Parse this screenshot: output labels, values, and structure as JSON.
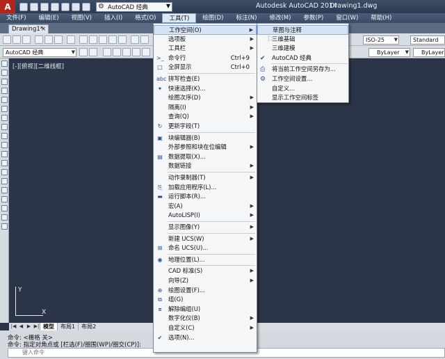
{
  "titlebar": {
    "app_title": "Autodesk AutoCAD 2014",
    "doc_title": "Drawing1.dwg",
    "workspace_select": "AutoCAD 经典",
    "logo": "A"
  },
  "menubar": [
    "文件(F)",
    "编辑(E)",
    "视图(V)",
    "插入(I)",
    "格式(O)",
    "工具(T)",
    "绘图(D)",
    "标注(N)",
    "修改(M)",
    "参数(P)",
    "窗口(W)",
    "帮助(H)"
  ],
  "doc_tab": {
    "label": "Drawing1*",
    "close": "×"
  },
  "toolbar": {
    "workspace_combo": "AutoCAD 经典",
    "dimstyle_combo": "ISO-25",
    "textstyle_combo": "Standard",
    "linetype_combo": "ByLayer",
    "lineweight_combo": "ByLayer"
  },
  "viewport_label": "[-][俯视][二维线框]",
  "ucs": {
    "x": "X",
    "y": "Y"
  },
  "layout_tabs": [
    "模型",
    "布局1",
    "布局2"
  ],
  "command": {
    "line1": "命令: <栅格 关>",
    "line2": "命令: 指定对角点或 [栏选(F)/圈围(WP)/圈交(CP)]:",
    "placeholder": "键入命令"
  },
  "tools_menu": [
    {
      "label": "工作空间(O)",
      "submenu": true,
      "highlight": true
    },
    {
      "label": "选项板",
      "submenu": true
    },
    {
      "label": "工具栏",
      "submenu": true
    },
    {
      "label": "命令行",
      "shortcut": "Ctrl+9",
      "icon": ">_"
    },
    {
      "label": "全屏显示",
      "shortcut": "Ctrl+0",
      "icon": "□"
    },
    {
      "sep": true
    },
    {
      "label": "拼写检查(E)",
      "icon": "abc"
    },
    {
      "label": "快速选择(K)...",
      "icon": "✦"
    },
    {
      "label": "绘图次序(D)",
      "submenu": true
    },
    {
      "label": "隔离(I)",
      "submenu": true
    },
    {
      "label": "查询(Q)",
      "submenu": true
    },
    {
      "label": "更新字段(T)",
      "icon": "↻"
    },
    {
      "sep": true
    },
    {
      "label": "块编辑器(B)",
      "icon": "▣"
    },
    {
      "label": "外部参照和块在位编辑",
      "submenu": true
    },
    {
      "label": "数据提取(X)...",
      "icon": "▤"
    },
    {
      "label": "数据链接",
      "submenu": true
    },
    {
      "sep": true
    },
    {
      "label": "动作录制器(T)",
      "submenu": true
    },
    {
      "label": "加载应用程序(L)...",
      "icon": "⎘"
    },
    {
      "label": "运行脚本(R)...",
      "icon": "▬"
    },
    {
      "label": "宏(A)",
      "submenu": true
    },
    {
      "label": "AutoLISP(I)",
      "submenu": true
    },
    {
      "sep": true
    },
    {
      "label": "显示图像(Y)",
      "submenu": true
    },
    {
      "sep": true
    },
    {
      "label": "新建 UCS(W)",
      "submenu": true
    },
    {
      "label": "命名 UCS(U)...",
      "icon": "⊞"
    },
    {
      "sep": true
    },
    {
      "label": "地理位置(L)...",
      "icon": "◉"
    },
    {
      "sep": true
    },
    {
      "label": "CAD 标准(S)",
      "submenu": true
    },
    {
      "label": "向导(Z)",
      "submenu": true
    },
    {
      "label": "绘图设置(F)...",
      "icon": "⊕"
    },
    {
      "label": "组(G)",
      "icon": "⧉"
    },
    {
      "label": "解除编组(U)",
      "icon": "⧈"
    },
    {
      "label": "数字化仪(B)",
      "submenu": true
    },
    {
      "label": "自定义(C)",
      "submenu": true
    },
    {
      "label": "选项(N)...",
      "icon": "✔"
    }
  ],
  "workspace_submenu": [
    {
      "label": "草图与注释",
      "highlight": true
    },
    {
      "label": "三维基础"
    },
    {
      "label": "三维建模"
    },
    {
      "label": "AutoCAD 经典",
      "checked": true
    },
    {
      "sep": true
    },
    {
      "label": "将当前工作空间另存为...",
      "icon": "⎙"
    },
    {
      "label": "工作空间设置...",
      "icon": "⚙"
    },
    {
      "label": "自定义..."
    },
    {
      "label": "显示工作空间标签"
    }
  ],
  "colors": {
    "canvas": "#2c3547",
    "menu_highlight": "#d5e3f4",
    "logo": "#b3261e"
  }
}
